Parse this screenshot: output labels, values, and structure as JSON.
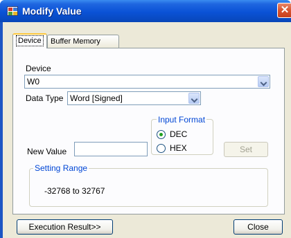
{
  "window": {
    "title": "Modify Value",
    "close_glyph": "✕",
    "app_icon": "app-grid-icon"
  },
  "tabs": [
    {
      "label": "Device",
      "selected": true
    },
    {
      "label": "Buffer Memory",
      "selected": false
    }
  ],
  "device": {
    "label": "Device",
    "value": "W0"
  },
  "data_type": {
    "label": "Data Type",
    "value": "Word [Signed]"
  },
  "input_format": {
    "title": "Input Format",
    "options": [
      {
        "label": "DEC",
        "checked": true
      },
      {
        "label": "HEX",
        "checked": false
      }
    ]
  },
  "new_value": {
    "label": "New Value",
    "value": ""
  },
  "set_button": {
    "label": "Set",
    "enabled": false
  },
  "setting_range": {
    "title": "Setting Range",
    "text": "-32768 to 32767"
  },
  "footer": {
    "execution_result_label": "Execution Result>>",
    "close_label": "Close"
  },
  "colors": {
    "titlebar": "#0a52d6",
    "dialog_bg": "#ece9d8",
    "group_title": "#0046d5",
    "close_button": "#d8532f"
  }
}
